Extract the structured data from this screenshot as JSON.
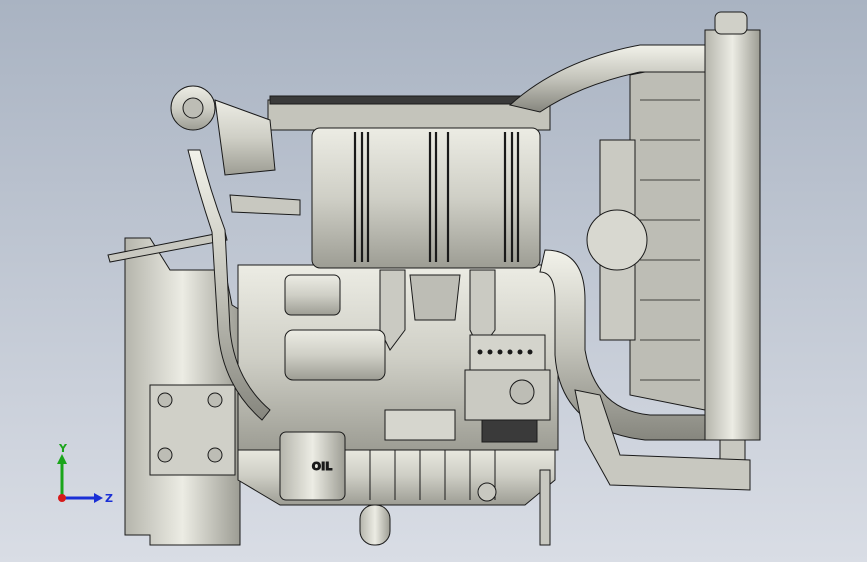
{
  "viewport": {
    "background_top": "#a9b3c2",
    "background_bottom": "#d9dde5",
    "model_fill": "#d8d8d0",
    "model_shadow": "#a8a8a0",
    "model_outline": "#1a1a1a"
  },
  "triad": {
    "y_label": "Y",
    "z_label": "Z",
    "y_color": "#1aa51a",
    "z_color": "#1a2fd6",
    "x_color": "#d61a1a"
  },
  "model": {
    "oil_filter_text": "OIL"
  }
}
